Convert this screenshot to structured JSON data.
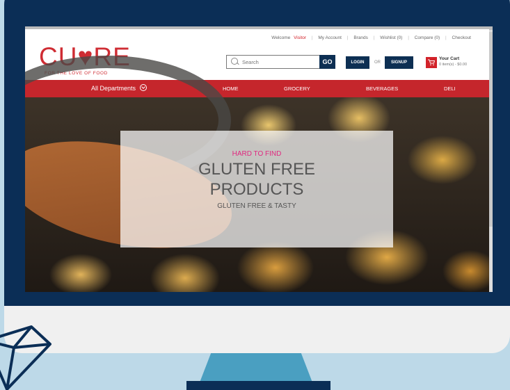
{
  "toplinks": {
    "welcome": "Welcome",
    "visitor": "Visitor",
    "my_account": "My Account",
    "brands": "Brands",
    "wishlist": "Wishlist (0)",
    "compare": "Compare (0)",
    "checkout": "Checkout"
  },
  "brand": {
    "logo": "CU♥RE",
    "tagline": "FOR THE LOVE OF FOOD"
  },
  "search": {
    "placeholder": "Search",
    "go_label": "GO"
  },
  "auth": {
    "login": "LOGIN",
    "or": "OR",
    "signup": "SIGNUP"
  },
  "cart": {
    "title": "Your Cart",
    "info": "0 item(s) - $0.00"
  },
  "nav": {
    "departments": "All Departments",
    "items": [
      "HOME",
      "GROCERY",
      "BEVERAGES",
      "DELI"
    ]
  },
  "hero": {
    "kicker": "HARD TO FIND",
    "title_line1": "GLUTEN FREE",
    "title_line2": "PRODUCTS",
    "subtitle": "GLUTEN FREE & TASTY"
  },
  "colors": {
    "brand_red": "#c5262c",
    "navy": "#0d2f53",
    "accent_pink": "#e0287f"
  }
}
